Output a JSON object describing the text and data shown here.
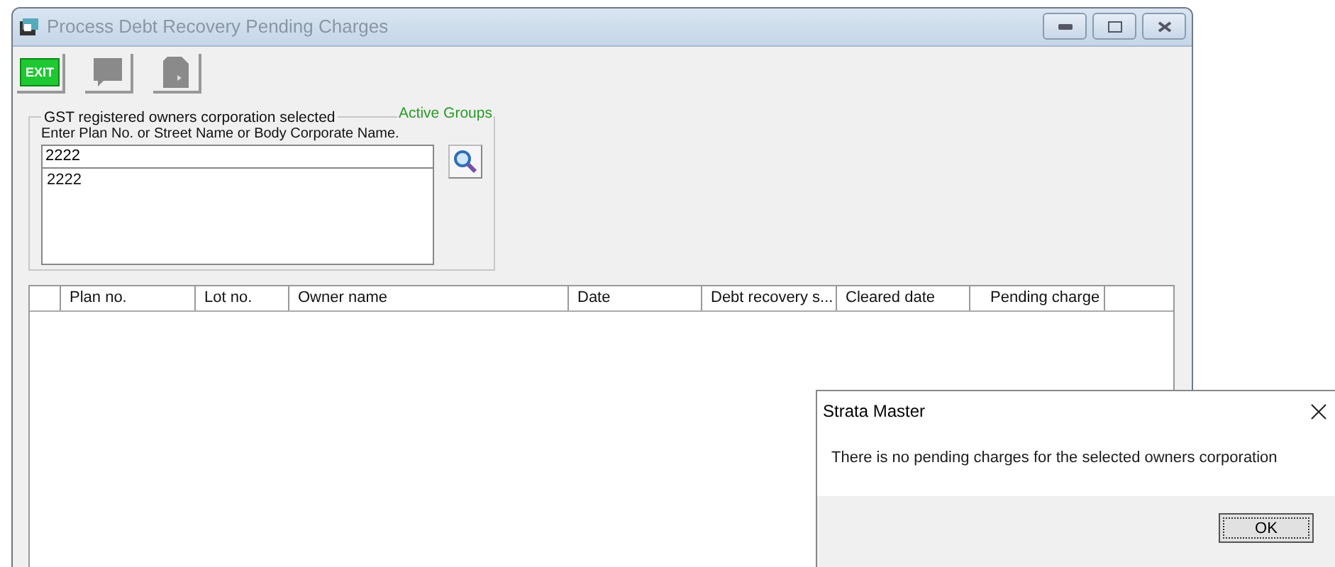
{
  "window": {
    "title": "Process Debt Recovery Pending Charges"
  },
  "toolbar": [
    {
      "kind": "exit",
      "label": "EXIT",
      "disabled": false
    },
    {
      "kind": "note",
      "disabled": true
    },
    {
      "kind": "document",
      "disabled": true
    }
  ],
  "group": {
    "legend": "GST registered owners corporation selected",
    "legend_right": "Active Groups",
    "prompt": "Enter Plan No. or Street Name or Body Corporate Name.",
    "search_value": "2222",
    "results": [
      "2222"
    ]
  },
  "table": {
    "columns": [
      "Plan no.",
      "Lot no.",
      "Owner name",
      "Date",
      "Debt recovery s...",
      "Cleared date",
      "Pending charge"
    ]
  },
  "dialog": {
    "title": "Strata Master",
    "message": "There is no pending charges for the selected owners corporation",
    "button": "OK"
  }
}
